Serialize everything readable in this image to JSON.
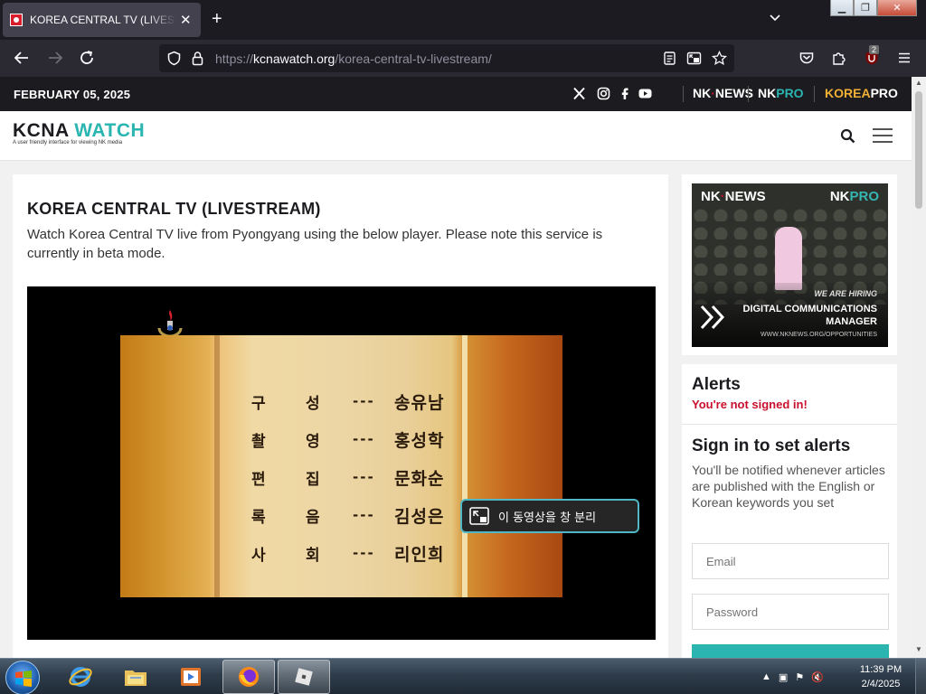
{
  "browser": {
    "tab_title": "KOREA CENTRAL TV (LIVESTREAM)",
    "tab_close": "✕",
    "new_tab": "+",
    "url_scheme": "https://",
    "url_domain": "kcnawatch.org",
    "url_path": "/korea-central-tv-livestream/",
    "extension_badge": "2"
  },
  "site": {
    "date": "FEBRUARY 05, 2025",
    "social_icons": [
      "x-icon",
      "instagram-icon",
      "facebook-icon",
      "youtube-icon"
    ],
    "brand_links": {
      "nknews_a": "NK",
      "nknews_b": "NEWS",
      "nkpro_a": "NK",
      "nkpro_b": " PRO",
      "koreapro_a": "KOREA",
      "koreapro_b": " PRO"
    },
    "logo_a": "KCNA ",
    "logo_b": "WATCH",
    "tagline": "A user friendly interface for viewing NK media",
    "accent": "#2ab5b1",
    "koreapro_color": "#f2b134"
  },
  "main": {
    "title": "KOREA CENTRAL TV (LIVESTREAM)",
    "intro": "Watch Korea Central TV live from Pyongyang using the below player. Please note this service is currently in beta mode.",
    "credits": [
      {
        "role_a": "구",
        "role_b": "성",
        "dash": "---",
        "person": "송유남"
      },
      {
        "role_a": "촬",
        "role_b": "영",
        "dash": "---",
        "person": "홍성학"
      },
      {
        "role_a": "편",
        "role_b": "집",
        "dash": "---",
        "person": "문화순"
      },
      {
        "role_a": "록",
        "role_b": "음",
        "dash": "---",
        "person": "김성은"
      },
      {
        "role_a": "사",
        "role_b": "회",
        "dash": "---",
        "person": "리인희"
      }
    ],
    "pip_label": "이 동영상을 창 분리"
  },
  "ad": {
    "brand_left_a": "NK",
    "brand_left_b": "NEWS",
    "brand_right_a": "NK",
    "brand_right_b": "PRO",
    "hiring": "WE ARE HIRING",
    "job": "DIGITAL COMMUNICATIONS MANAGER",
    "site": "WWW.NKNEWS.ORG/OPPORTUNITIES"
  },
  "alerts": {
    "heading": "Alerts",
    "status": "You're not signed in!",
    "signin_heading": "Sign in to set alerts",
    "signin_text": "You'll be notified whenever articles are published with the English or Korean keywords you set",
    "email_placeholder": "Email",
    "password_placeholder": "Password"
  },
  "taskbar": {
    "apps": [
      "internet-explorer-icon",
      "file-explorer-icon",
      "media-player-icon",
      "firefox-icon",
      "roblox-icon"
    ],
    "time": "11:39 PM",
    "date": "2/4/2025"
  }
}
